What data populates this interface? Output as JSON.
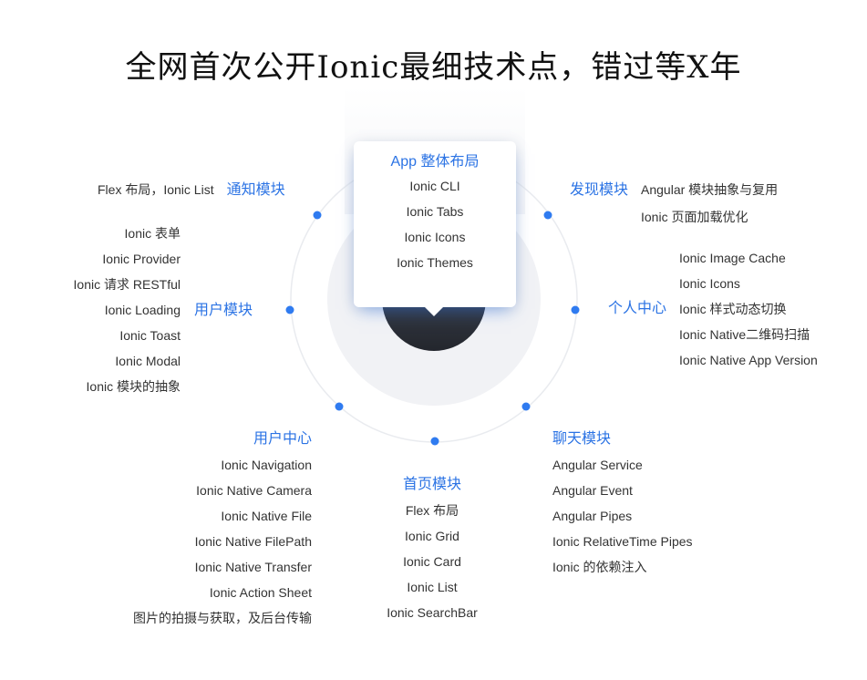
{
  "title": "全网首次公开Ionic最细技术点，错过等X年",
  "center_card": {
    "heading": "App 整体布局",
    "items": [
      "Ionic CLI",
      "Ionic Tabs",
      "Ionic Icons",
      "Ionic Themes"
    ]
  },
  "modules": {
    "notify": {
      "heading": "通知模块",
      "items": [
        "Flex 布局，Ionic List"
      ]
    },
    "discover": {
      "heading": "发现模块",
      "items": [
        "Angular 模块抽象与复用",
        "Ionic 页面加载优化"
      ]
    },
    "user_module": {
      "heading": "用户模块",
      "items": [
        "Ionic 表单",
        "Ionic Provider",
        "Ionic 请求 RESTful",
        "Ionic Loading",
        "Ionic Toast",
        "Ionic Modal",
        "Ionic 模块的抽象"
      ]
    },
    "personal": {
      "heading": "个人中心",
      "items": [
        "Ionic Image Cache",
        "Ionic Icons",
        "Ionic 样式动态切换",
        "Ionic Native二维码扫描",
        "Ionic Native App Version"
      ]
    },
    "user_center": {
      "heading": "用户中心",
      "items": [
        "Ionic Navigation",
        "Ionic Native Camera",
        "Ionic Native File",
        "Ionic Native FilePath",
        "Ionic Native Transfer",
        "Ionic Action Sheet",
        "图片的拍摄与获取，及后台传输"
      ]
    },
    "chat": {
      "heading": "聊天模块",
      "items": [
        "Angular Service",
        "Angular Event",
        "Angular Pipes",
        "Ionic RelativeTime Pipes",
        "Ionic 的依赖注入"
      ]
    },
    "home": {
      "heading": "首页模块",
      "items": [
        "Flex 布局",
        "Ionic Grid",
        "Ionic Card",
        "Ionic List",
        "Ionic SearchBar"
      ]
    }
  },
  "colors": {
    "accent": "#2b73e4",
    "dot": "#2f7bf0",
    "ring": "#e9ebef",
    "hub_dark": "#2e323c",
    "hub_light": "#f1f2f5",
    "text": "#333333"
  }
}
